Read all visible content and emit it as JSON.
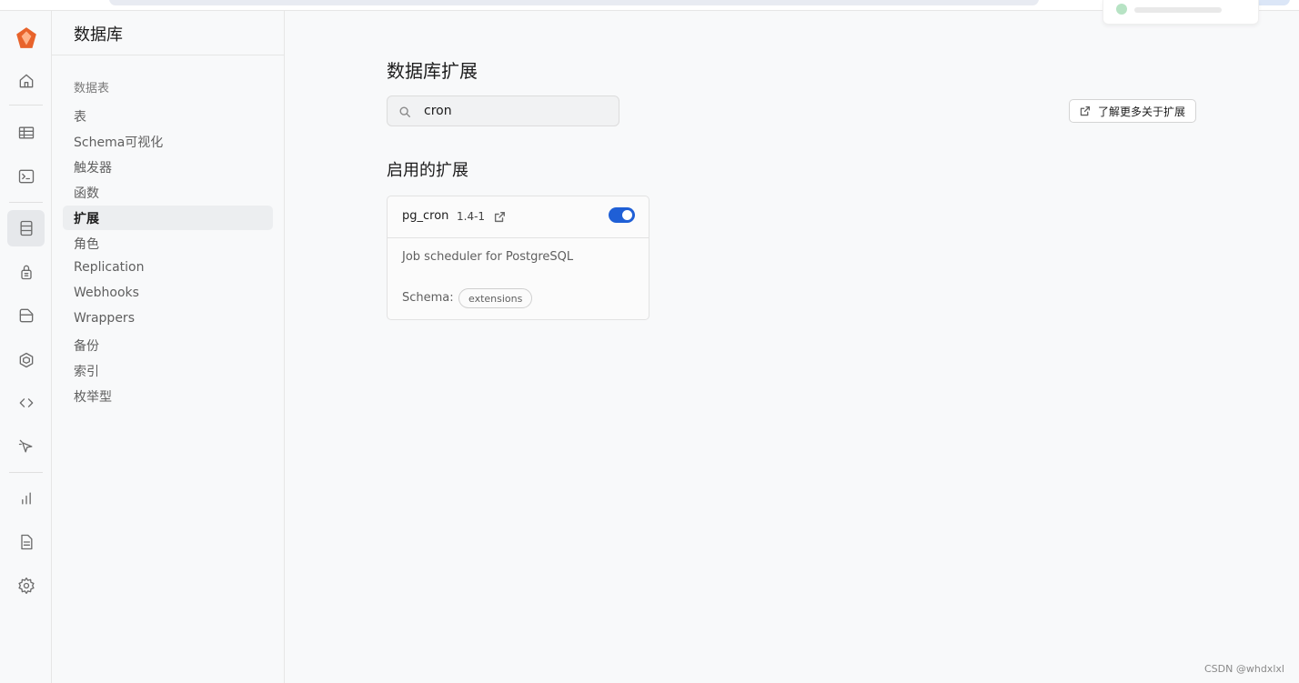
{
  "sidebar": {
    "title": "数据库",
    "section_label": "数据表",
    "items": [
      {
        "label": "表"
      },
      {
        "label": "Schema可视化"
      },
      {
        "label": "触发器"
      },
      {
        "label": "函数"
      },
      {
        "label": "扩展",
        "active": true
      },
      {
        "label": "角色"
      },
      {
        "label": "Replication"
      },
      {
        "label": "Webhooks"
      },
      {
        "label": "Wrappers"
      },
      {
        "label": "备份"
      },
      {
        "label": "索引"
      },
      {
        "label": "枚举型"
      }
    ]
  },
  "rail": {
    "icons": [
      "logo-icon",
      "home-icon",
      "table-editor-icon",
      "sql-editor-icon",
      "database-icon",
      "auth-icon",
      "storage-icon",
      "edge-functions-icon",
      "api-icon",
      "advisor-icon",
      "reports-icon",
      "logs-icon",
      "settings-icon"
    ],
    "active": "database-icon",
    "logo_color": "#e8632b"
  },
  "main": {
    "title": "数据库扩展",
    "search": {
      "value": "cron",
      "placeholder": ""
    },
    "learn_more_label": "了解更多关于扩展",
    "enabled_section_title": "启用的扩展",
    "extensions": [
      {
        "name": "pg_cron",
        "version": "1.4-1",
        "enabled": true,
        "description": "Job scheduler for PostgreSQL",
        "schema_label": "Schema:",
        "schema": "extensions"
      }
    ]
  },
  "accent_color": "#1f5fd6",
  "watermark": "CSDN @whdxlxl"
}
